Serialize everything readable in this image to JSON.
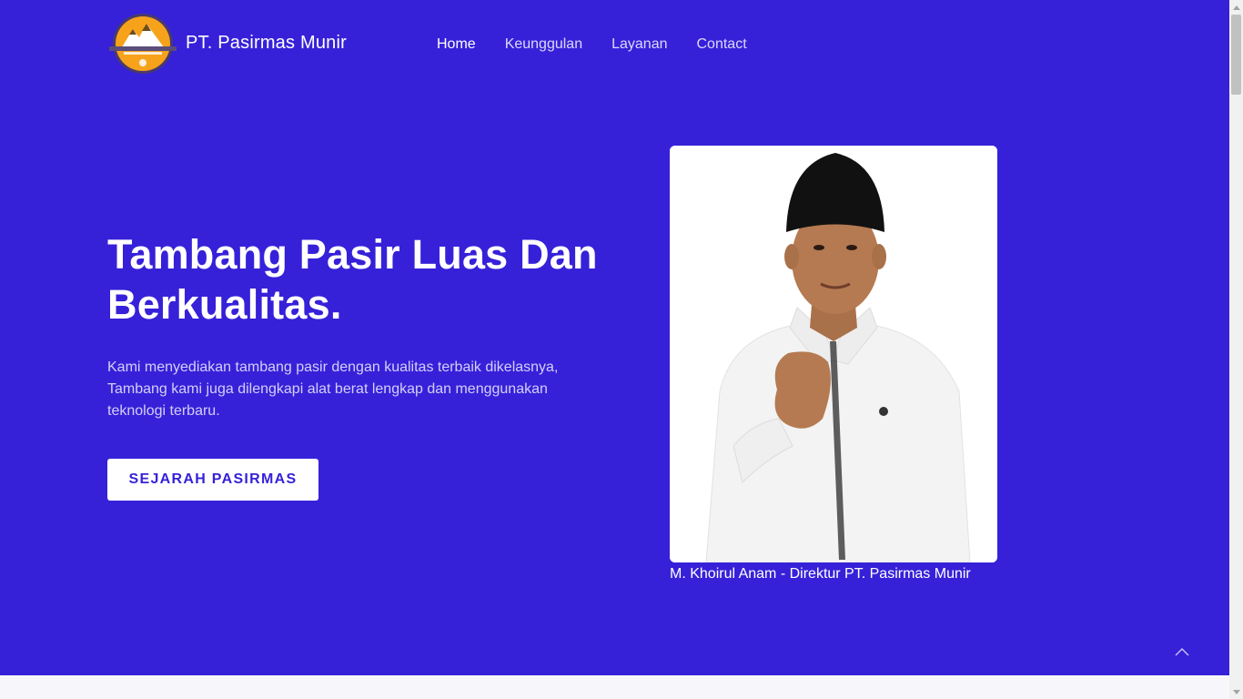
{
  "brand": {
    "name": "PT. Pasirmas Munir",
    "logo_icon": "pasirmas-mountain-logo-icon"
  },
  "nav": {
    "items": [
      {
        "label": "Home",
        "active": true
      },
      {
        "label": "Keunggulan",
        "active": false
      },
      {
        "label": "Layanan",
        "active": false
      },
      {
        "label": "Contact",
        "active": false
      }
    ]
  },
  "hero": {
    "title_line1": "Tambang Pasir Luas Dan",
    "title_line2": "Berkualitas.",
    "description": "Kami menyediakan tambang pasir dengan kualitas terbaik dikelasnya, Tambang kami juga dilengkapi alat berat lengkap dan menggunakan teknologi terbaru.",
    "cta_label": "SEJARAH PASIRMAS"
  },
  "portrait": {
    "caption": "M. Khoirul Anam - Direktur PT. Pasirmas Munir"
  },
  "icons": {
    "scroll_top": "chevron-up-icon"
  },
  "colors": {
    "primary": "#3621d9",
    "logo_orange": "#f7a21b",
    "text": "#ffffff"
  }
}
